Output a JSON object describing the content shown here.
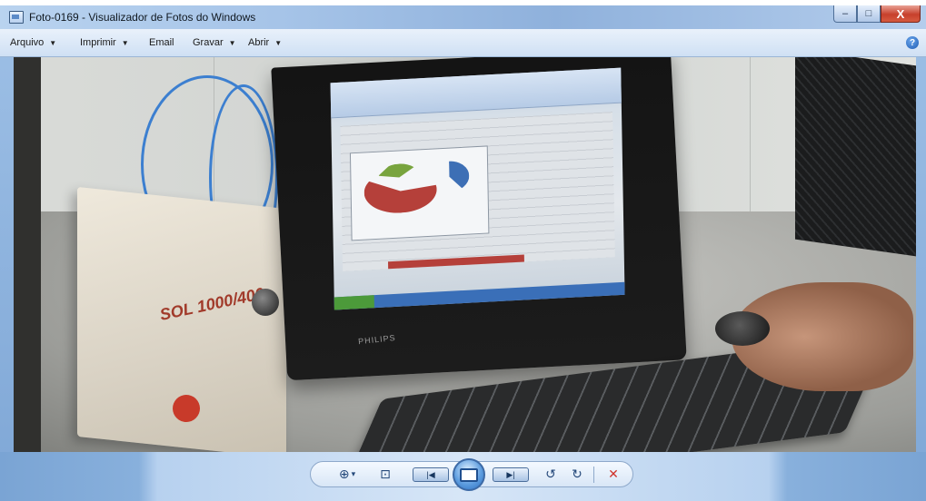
{
  "window": {
    "title": "Foto-0169 - Visualizador de Fotos do Windows",
    "controls": {
      "minimize": "–",
      "maximize": "□",
      "close": "X"
    }
  },
  "menu": {
    "items": [
      {
        "label": "Arquivo",
        "has_dropdown": true
      },
      {
        "label": "Imprimir",
        "has_dropdown": true
      },
      {
        "label": "Email",
        "has_dropdown": false
      },
      {
        "label": "Gravar",
        "has_dropdown": true
      },
      {
        "label": "Abrir",
        "has_dropdown": true
      }
    ],
    "help_glyph": "?"
  },
  "photo": {
    "stabilizer_label": "SOL 1000/400",
    "monitor_brand": "PHILIPS"
  },
  "controls": {
    "zoom_glyph": "⊕",
    "zoom_caret": "▾",
    "fit_glyph": "⊡",
    "previous_glyph": "|◀",
    "next_glyph": "▶|",
    "rotate_ccw_glyph": "↺",
    "rotate_cw_glyph": "↻",
    "delete_glyph": "✕"
  },
  "colors": {
    "accent": "#2b6fc1",
    "delete": "#d0342c"
  },
  "icons": [
    "window-icon",
    "help-icon",
    "zoom-icon",
    "fit-icon",
    "previous-icon",
    "slideshow-icon",
    "next-icon",
    "rotate-left-icon",
    "rotate-right-icon",
    "delete-icon"
  ]
}
